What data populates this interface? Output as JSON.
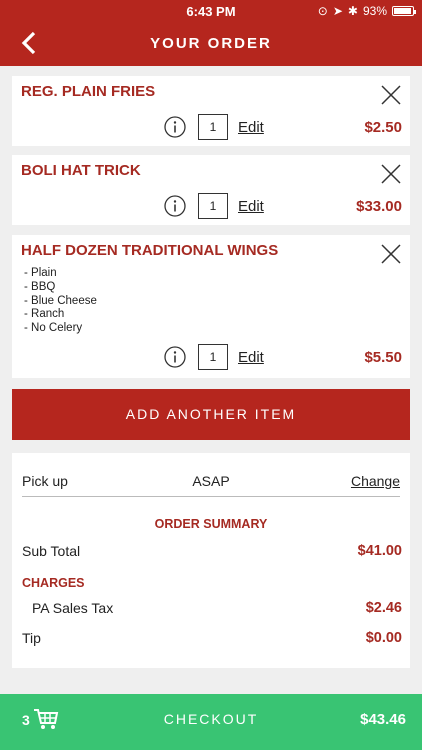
{
  "status": {
    "time": "6:43 PM",
    "battery": "93%"
  },
  "header": {
    "title": "YOUR ORDER"
  },
  "items": [
    {
      "name": "REG. PLAIN FRIES",
      "qty": "1",
      "edit": "Edit",
      "price": "$2.50",
      "modifiers": []
    },
    {
      "name": "BOLI HAT TRICK",
      "qty": "1",
      "edit": "Edit",
      "price": "$33.00",
      "modifiers": []
    },
    {
      "name": "HALF DOZEN TRADITIONAL WINGS",
      "qty": "1",
      "edit": "Edit",
      "price": "$5.50",
      "modifiers": [
        "- Plain",
        "- BBQ",
        "- Blue Cheese",
        "- Ranch",
        "- No Celery"
      ]
    }
  ],
  "add_button": "ADD ANOTHER ITEM",
  "pickup": {
    "label": "Pick up",
    "value": "ASAP",
    "change": "Change"
  },
  "summary": {
    "heading": "ORDER SUMMARY",
    "subtotal_label": "Sub Total",
    "subtotal_value": "$41.00",
    "charges_heading": "CHARGES",
    "tax_label": "PA Sales Tax",
    "tax_value": "$2.46",
    "tip_label": "Tip",
    "tip_value": "$0.00"
  },
  "checkout": {
    "count": "3",
    "label": "CHECKOUT",
    "total": "$43.46"
  },
  "colors": {
    "brand_red": "#b5261e",
    "accent_text": "#a52a22",
    "checkout_green": "#39c473",
    "background": "#efefef"
  }
}
